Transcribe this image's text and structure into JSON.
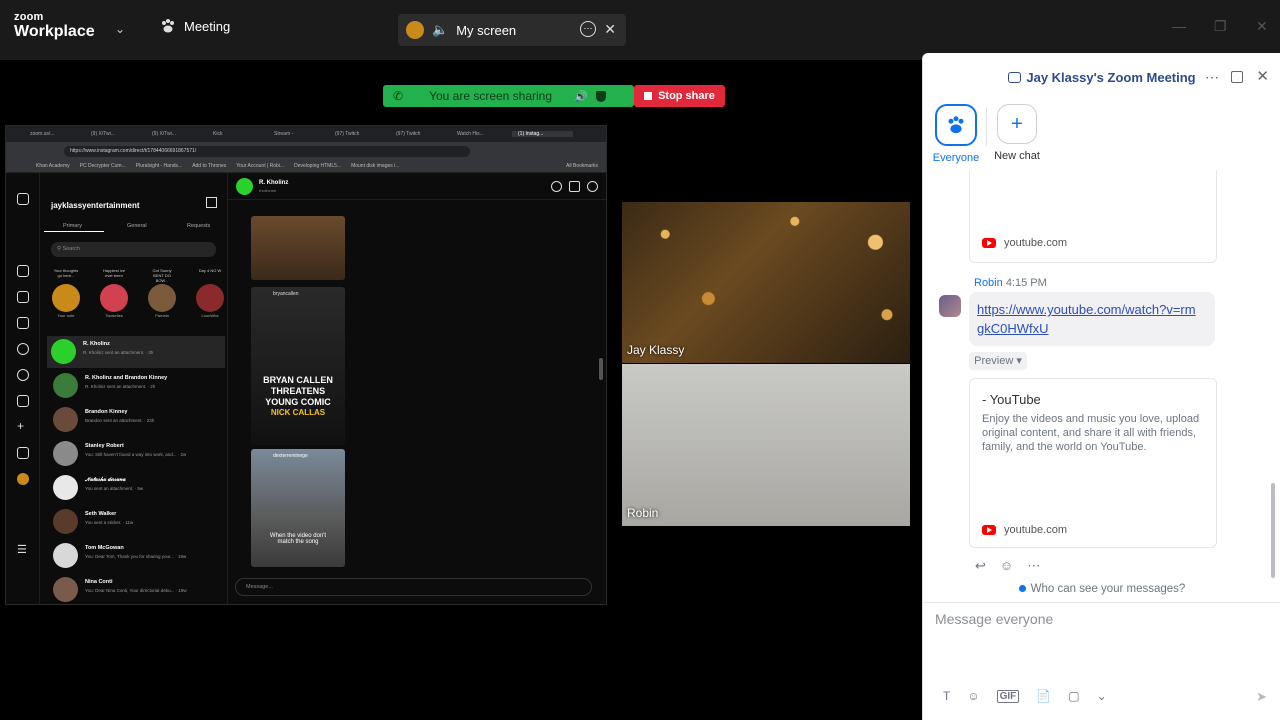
{
  "topbar": {
    "logo_top": "zoom",
    "logo_bottom": "Workplace",
    "meeting_label": "Meeting",
    "screen_label": "My screen"
  },
  "banner": {
    "status_text": "You are screen sharing",
    "stop_label": "Stop share",
    "status_color": "#22b14c",
    "stop_color": "#e2293c"
  },
  "shared_screen": {
    "tabs": [
      "zoom.us/...",
      "(9) X/Twi...",
      "(9) X/Twi...",
      "Kick",
      "Stream -",
      "(97) Twitch",
      "(97) Twitch",
      "Watch His...",
      "(1) Instag..."
    ],
    "url": "https://www.instagram.com/direct/t/17844066691867571/",
    "bookmarks": [
      "Khan Academy",
      "PC Decrypter Cum...",
      "Pluralsight - Hands...",
      "Add to Thrones",
      "Your Account | Robi...",
      "Developing HTML5...",
      "Mount disk images i...",
      "All Bookmarks"
    ],
    "account": "jaykIassyentertainment",
    "tabs_labels": [
      "Primary",
      "General",
      "Requests"
    ],
    "search_placeholder": "Search",
    "notes": [
      {
        "bubble": "Your thoughts go here...",
        "name": "Your note"
      },
      {
        "bubble": "Happiest ive ever been",
        "name": "Twoseties"
      },
      {
        "bubble": "Got Sunny BENT DO BOW...",
        "name": "Pamela"
      },
      {
        "bubble": "Day 4 NO W",
        "name": "LoonWhe"
      }
    ],
    "conversations": [
      {
        "name": "R. Kholinz",
        "msg": "R. Kholinz sent an attachment. · 3h"
      },
      {
        "name": "R. Kholinz and Brandon Kinney",
        "msg": "R. Kholinz sent an attachment. · 2h"
      },
      {
        "name": "Brandon Kinney",
        "msg": "Brandon sent an attachment. · 23h"
      },
      {
        "name": "Stanley Robert",
        "msg": "You: Still haven't found a way into work, and... · 2w"
      },
      {
        "name": "𝒩𝒶𝓉𝒶𝓈𝒽𝒶 𝒹𝒾𝓈𝓈𝒶𝓃𝒶",
        "msg": "You sent an attachment. · 5w"
      },
      {
        "name": "Seth Walker",
        "msg": "You sent a sticker. · 11w"
      },
      {
        "name": "Tom McGowan",
        "msg": "You: Dear Tom, Thank you for sharing your... · 19w"
      },
      {
        "name": "Nina Conti",
        "msg": "You: Dear Nina Conti, Your directorial debu... · 19w"
      }
    ],
    "chat_header_name": "R. Kholinz",
    "chat_header_sub": "rholinzme",
    "reel_user_1": "bryancallen",
    "reel_caption_1a": "BRYAN CALLEN",
    "reel_caption_1b": "THREATENS",
    "reel_caption_1c": "YOUNG COMIC",
    "reel_caption_1d": "NICK CALLAS",
    "reel_user_2": "dexterreminege",
    "reel_caption_2": "When the video don't match the song",
    "message_placeholder": "Message..."
  },
  "videos": [
    {
      "name": "Jay Klassy"
    },
    {
      "name": "Robin"
    }
  ],
  "panel": {
    "title": "Jay Klassy's Zoom Meeting",
    "channels": [
      {
        "label": "Everyone"
      },
      {
        "label": "New chat"
      }
    ],
    "prev_card_domain": "youtube.com",
    "sender": "Robin",
    "time": "4:15 PM",
    "link": "https://www.youtube.com/watch?v=rmgkC0HWfxU",
    "preview_label": "Preview ▾",
    "card_title": "- YouTube",
    "card_desc": "Enjoy the videos and music you love, upload original content, and share it all with friends, family, and the world on YouTube.",
    "card_domain": "youtube.com",
    "who_label": "Who can see your messages?",
    "composer_placeholder": "Message everyone",
    "toolbar_gif": "GIF",
    "accent_color": "#0e72ed"
  }
}
